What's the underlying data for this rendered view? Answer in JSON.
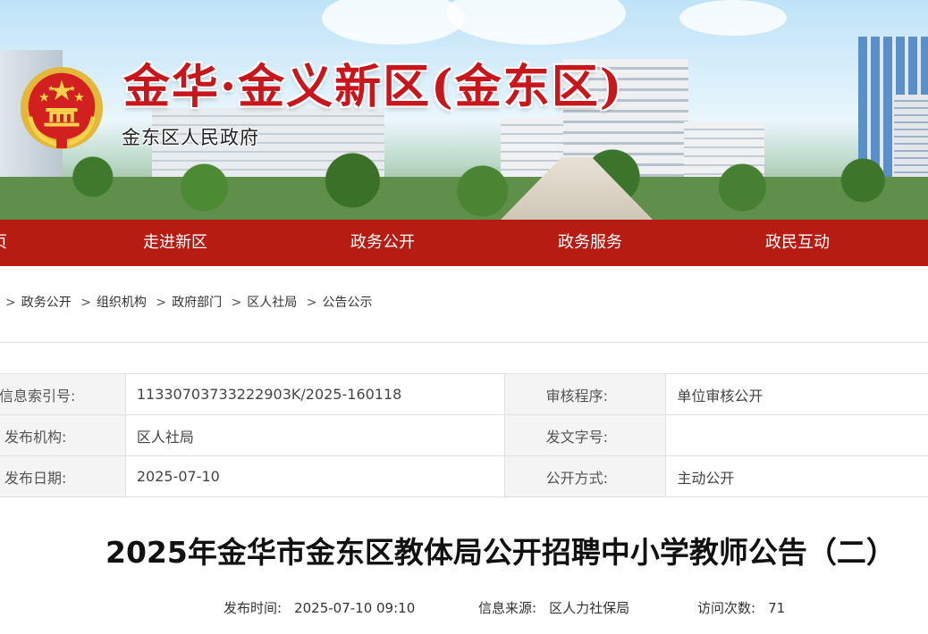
{
  "banner": {
    "title": "金华·金义新区(金东区)",
    "subtitle": "金东区人民政府"
  },
  "nav": {
    "items": [
      "页",
      "走进新区",
      "政务公开",
      "政务服务",
      "政民互动"
    ]
  },
  "breadcrumb": {
    "items": [
      "政务公开",
      "组织机构",
      "政府部门",
      "区人社局",
      "公告公示"
    ],
    "separator": ">"
  },
  "info": {
    "index_label": "信息索引号:",
    "index_value": "11330703733222903K/2025-160118",
    "review_label": "审核程序:",
    "review_value": "单位审核公开",
    "publisher_label": "发布机构:",
    "publisher_value": "区人社局",
    "docno_label": "发文字号:",
    "docno_value": "",
    "date_label": "发布日期:",
    "date_value": "2025-07-10",
    "method_label": "公开方式:",
    "method_value": "主动公开"
  },
  "article": {
    "title": "2025年金华市金东区教体局公开招聘中小学教师公告（二）",
    "publish_time_label": "发布时间:",
    "publish_time": "2025-07-10 09:10",
    "source_label": "信息来源:",
    "source": "区人力社保局",
    "visits_label": "访问次数:",
    "visits": "71"
  },
  "colors": {
    "nav_bg": "#b71c12",
    "title_red": "#c8161d"
  }
}
